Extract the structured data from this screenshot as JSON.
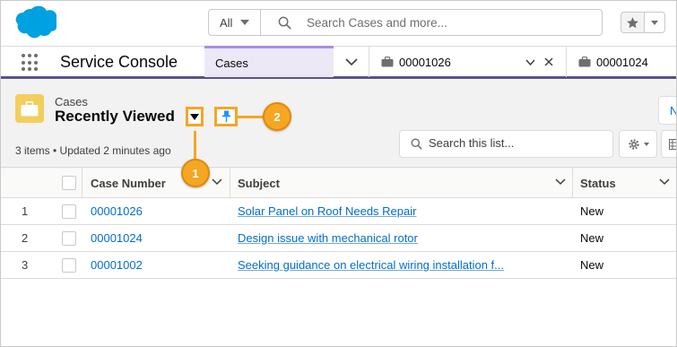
{
  "header": {
    "search_scope": "All",
    "search_placeholder": "Search Cases and more..."
  },
  "nav": {
    "app_name": "Service Console",
    "active_tab": "Cases",
    "subtabs": [
      {
        "label": "00001026"
      },
      {
        "label": "00001024"
      }
    ]
  },
  "list": {
    "object_label": "Cases",
    "view_name": "Recently Viewed",
    "meta": "3 items • Updated 2 minutes ago",
    "new_button_label": "N",
    "search_placeholder": "Search this list...",
    "callouts": [
      "1",
      "2"
    ],
    "columns": [
      "Case Number",
      "Subject",
      "Status"
    ],
    "rows": [
      {
        "num": "1",
        "case_number": "00001026",
        "subject": "Solar Panel on Roof Needs Repair",
        "status": "New"
      },
      {
        "num": "2",
        "case_number": "00001024",
        "subject": "Design issue with mechanical rotor",
        "status": "New"
      },
      {
        "num": "3",
        "case_number": "00001002",
        "subject": "Seeking guidance on electrical wiring installation f...",
        "status": "New"
      }
    ]
  },
  "colors": {
    "brand_blue": "#00a1e0",
    "link": "#006dcc",
    "callout_orange": "#f5a623",
    "nav_accent": "#5d4f8a",
    "active_tab_bg": "#ece8f6",
    "case_icon": "#f2cf5b"
  }
}
